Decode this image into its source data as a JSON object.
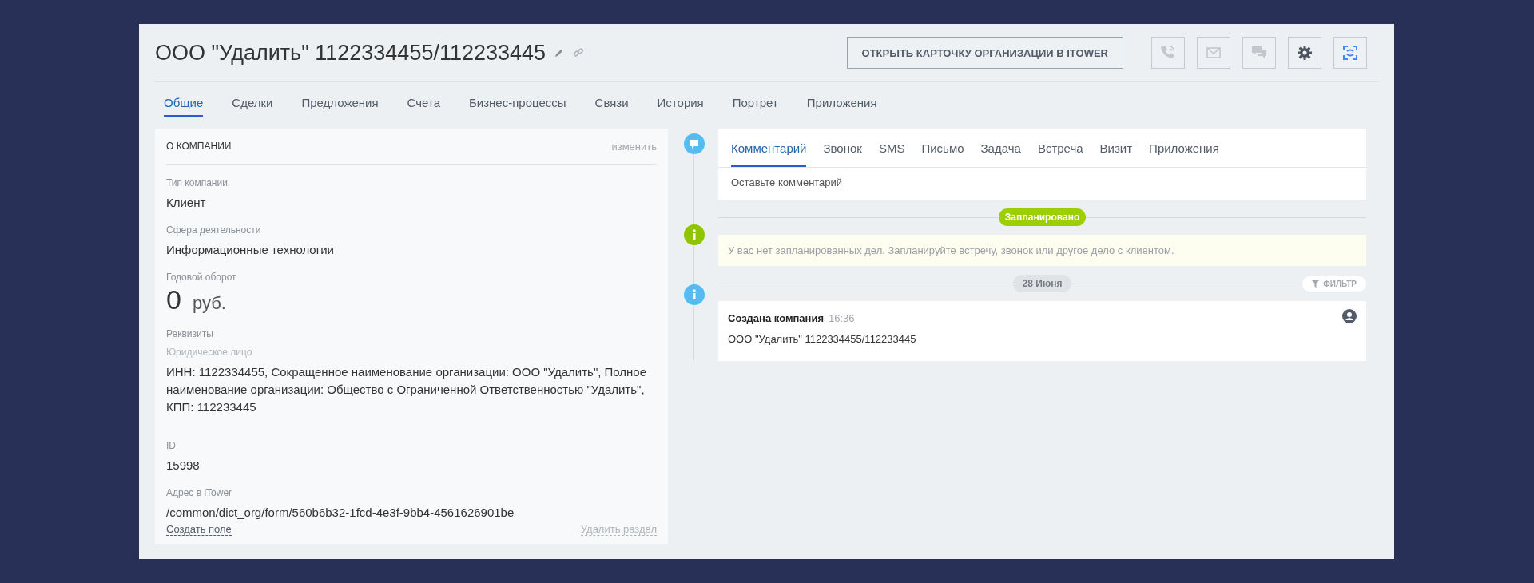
{
  "title": "ООО \"Удалить\" 1122334455/112233445",
  "header_button": "ОТКРЫТЬ КАРТОЧКУ ОРГАНИЗАЦИИ В ITOWER",
  "tool_buttons": [
    {
      "kind": "phone"
    },
    {
      "kind": "mail"
    },
    {
      "kind": "chat"
    },
    {
      "kind": "settings"
    },
    {
      "kind": "sync"
    }
  ],
  "tabs": [
    {
      "label": "Общие",
      "selected": true
    },
    {
      "label": "Сделки",
      "selected": false
    },
    {
      "label": "Предложения",
      "selected": false
    },
    {
      "label": "Счета",
      "selected": false
    },
    {
      "label": "Бизнес-процессы",
      "selected": false
    },
    {
      "label": "Связи",
      "selected": false
    },
    {
      "label": "История",
      "selected": false
    },
    {
      "label": "Портрет",
      "selected": false
    },
    {
      "label": "Приложения",
      "selected": false
    }
  ],
  "about": {
    "title": "О КОМПАНИИ",
    "edit": "изменить",
    "fields": [
      {
        "kind": "text",
        "label": "Тип компании",
        "value": "Клиент"
      },
      {
        "kind": "text",
        "label": "Сфера деятельности",
        "value": "Информационные технологии"
      },
      {
        "kind": "amount",
        "label": "Годовой оборот",
        "value": "0",
        "unit": "руб."
      },
      {
        "kind": "requisites",
        "label": "Реквизиты",
        "sublabel": "Юридическое лицо",
        "value": "ИНН: 1122334455, Сокращенное наименование организации: ООО \"Удалить\", Полное наименование организации: Общество с Ограниченной Ответственностью \"Удалить\", КПП: 112233445"
      },
      {
        "kind": "text",
        "label": "ID",
        "value": "15998"
      },
      {
        "kind": "text",
        "label": "Адрес в iTower",
        "value": "/common/dict_org/form/560b6b32-1fcd-4e3f-9bb4-4561626901be"
      }
    ],
    "create_field": "Создать поле",
    "delete_section": "Удалить раздел"
  },
  "activity": {
    "tabs": [
      {
        "label": "Комментарий",
        "selected": true
      },
      {
        "label": "Звонок",
        "selected": false
      },
      {
        "label": "SMS",
        "selected": false
      },
      {
        "label": "Письмо",
        "selected": false
      },
      {
        "label": "Задача",
        "selected": false
      },
      {
        "label": "Встреча",
        "selected": false
      },
      {
        "label": "Визит",
        "selected": false
      },
      {
        "label": "Приложения",
        "selected": false
      }
    ],
    "placeholder": "Оставьте комментарий",
    "planned_badge": "Запланировано",
    "notice": "У вас нет запланированных дел. Запланируйте встречу, звонок или другое дело с клиентом.",
    "date": "28 Июня",
    "filter": "ФИЛЬТР",
    "events": [
      {
        "title": "Создана компания",
        "time": "16:36",
        "text": "ООО \"Удалить\" 1122334455/112233445"
      }
    ]
  }
}
